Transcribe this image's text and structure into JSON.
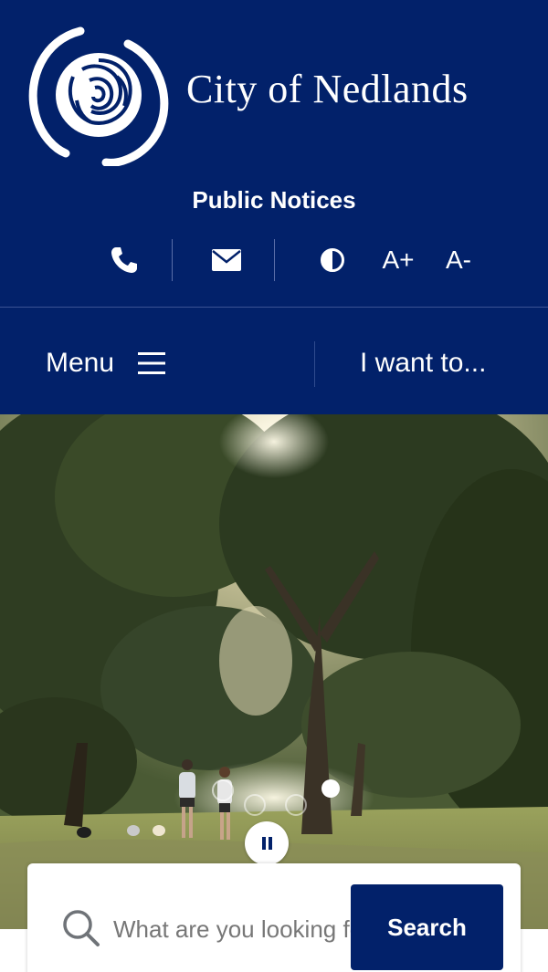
{
  "site": {
    "name": "City of Nedlands",
    "logo_icon": "rose-icon"
  },
  "header": {
    "public_notices": "Public Notices",
    "utility": {
      "phone_icon": "phone-icon",
      "email_icon": "envelope-icon",
      "contrast_icon": "contrast-icon",
      "increase_text": "A+",
      "decrease_text": "A-"
    }
  },
  "nav": {
    "menu_label": "Menu",
    "menu_icon": "hamburger-icon",
    "i_want_to_label": "I want to..."
  },
  "hero": {
    "pause_icon": "pause-icon"
  },
  "search": {
    "placeholder": "What are you looking for?",
    "button_label": "Search",
    "icon": "search-icon"
  },
  "colors": {
    "brand_navy": "#02216a",
    "white": "#ffffff"
  }
}
